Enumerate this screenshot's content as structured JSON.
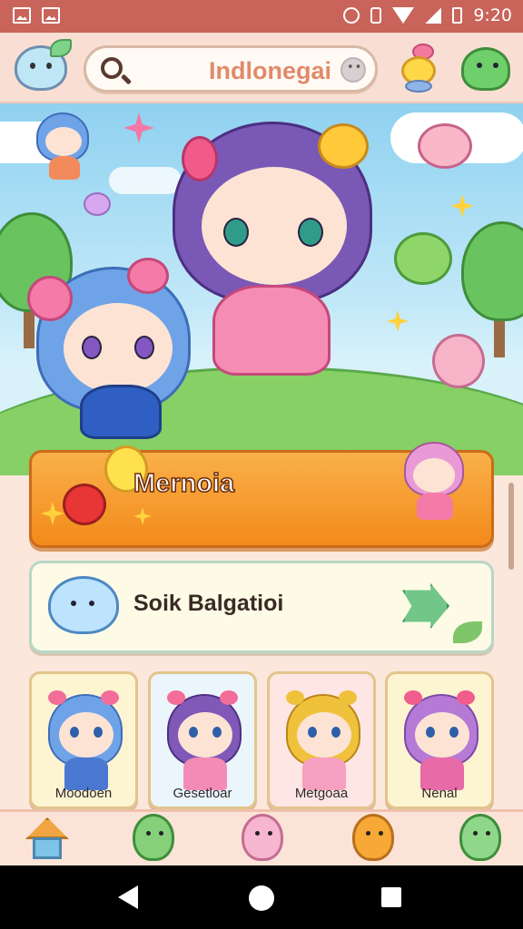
{
  "status_bar": {
    "time": "9:20"
  },
  "search": {
    "value": "Indlonegai"
  },
  "hero": {},
  "cards": [
    {
      "title": "Mernoia"
    },
    {
      "title": "Soik Balgatioi"
    }
  ],
  "characters": [
    {
      "label": "Moodoen",
      "hair": "#6fa3e8",
      "hair_dark": "#3e6db8",
      "dress": "#4a78d0",
      "bow": "#f26d9a",
      "bg": "#fdf4d2"
    },
    {
      "label": "Gesetloar",
      "hair": "#7f58b8",
      "hair_dark": "#4f3080",
      "dress": "#f48bb6",
      "bow": "#f26d9a",
      "bg": "#eaf6fb"
    },
    {
      "label": "Metgoaa",
      "hair": "#f0c13a",
      "hair_dark": "#b9861a",
      "dress": "#f5a0c0",
      "bow": "#f0c13a",
      "bg": "#fde6e4"
    },
    {
      "label": "Nenal",
      "hair": "#b57ad6",
      "hair_dark": "#7d48a5",
      "dress": "#e86aa6",
      "bow": "#f05c8c",
      "bg": "#fdf4d2"
    }
  ],
  "bottom_nav": [
    {
      "name": "home-icon"
    },
    {
      "name": "frog-character-icon",
      "color": "#86d07a",
      "border": "#3e8e3c"
    },
    {
      "name": "pink-bear-icon",
      "color": "#f6b6cf",
      "border": "#c66c92"
    },
    {
      "name": "orange-bear-icon",
      "color": "#f7a836",
      "border": "#b8701c"
    },
    {
      "name": "green-dino-icon",
      "color": "#8fd88a",
      "border": "#3e8e3c"
    }
  ],
  "colors": {
    "status_bar": "#c9645a",
    "accent_orange": "#f38a1a",
    "search_text": "#e08a6a",
    "background": "#fbe7dc"
  }
}
